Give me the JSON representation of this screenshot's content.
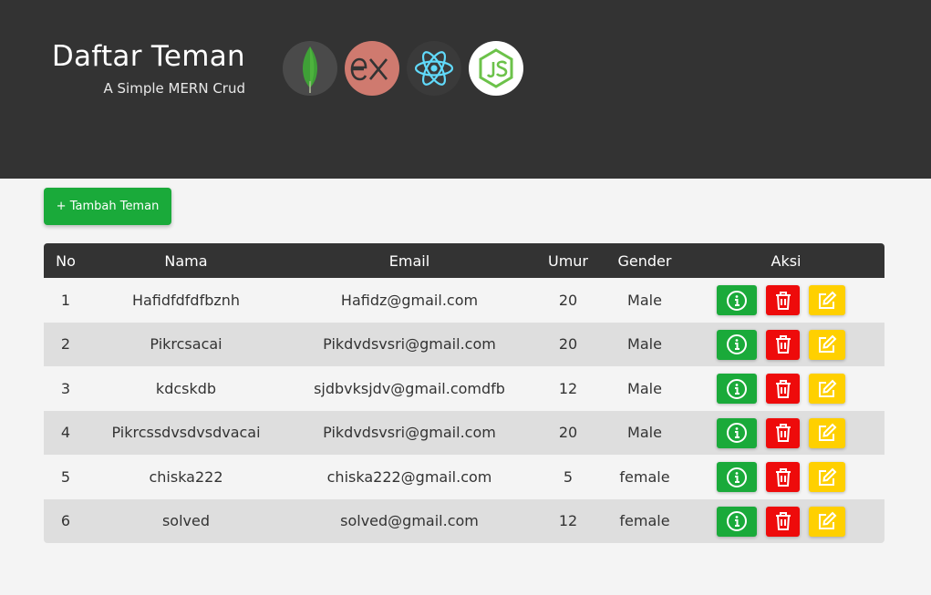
{
  "header": {
    "title": "Daftar Teman",
    "subtitle": "A Simple MERN Crud",
    "logos": [
      {
        "name": "mongodb-logo",
        "bg": "#4a4a4a"
      },
      {
        "name": "express-logo",
        "bg": "#cf7a6f"
      },
      {
        "name": "react-logo",
        "bg": "#3a3a3a"
      },
      {
        "name": "nodejs-logo",
        "bg": "#ffffff"
      }
    ]
  },
  "toolbar": {
    "add_label": "+ Tambah Teman"
  },
  "table": {
    "columns": [
      "No",
      "Nama",
      "Email",
      "Umur",
      "Gender",
      "Aksi"
    ],
    "rows": [
      {
        "no": "1",
        "nama": "Hafidfdfdfbznh",
        "email": "Hafidz@gmail.com",
        "umur": "20",
        "gender": "Male"
      },
      {
        "no": "2",
        "nama": "Pikrcsacai",
        "email": "Pikdvdsvsri@gmail.com",
        "umur": "20",
        "gender": "Male"
      },
      {
        "no": "3",
        "nama": "kdcskdb",
        "email": "sjdbvksjdv@gmail.comdfb",
        "umur": "12",
        "gender": "Male"
      },
      {
        "no": "4",
        "nama": "Pikrcssdvsdvsdvacai",
        "email": "Pikdvdsvsri@gmail.com",
        "umur": "20",
        "gender": "Male"
      },
      {
        "no": "5",
        "nama": "chiska222",
        "email": "chiska222@gmail.com",
        "umur": "5",
        "gender": "female"
      },
      {
        "no": "6",
        "nama": "solved",
        "email": "solved@gmail.com",
        "umur": "12",
        "gender": "female"
      }
    ],
    "actions": [
      {
        "name": "info",
        "icon": "info-circle-icon",
        "color": "#1aaa3a"
      },
      {
        "name": "delete",
        "icon": "trash-icon",
        "color": "#ee0b0b"
      },
      {
        "name": "edit",
        "icon": "edit-icon",
        "color": "#ffd000"
      }
    ]
  },
  "colors": {
    "header_bg": "#333333",
    "page_bg": "#f4f4f4",
    "stripe_bg": "#dedede",
    "accent_green": "#1aaa3a"
  }
}
